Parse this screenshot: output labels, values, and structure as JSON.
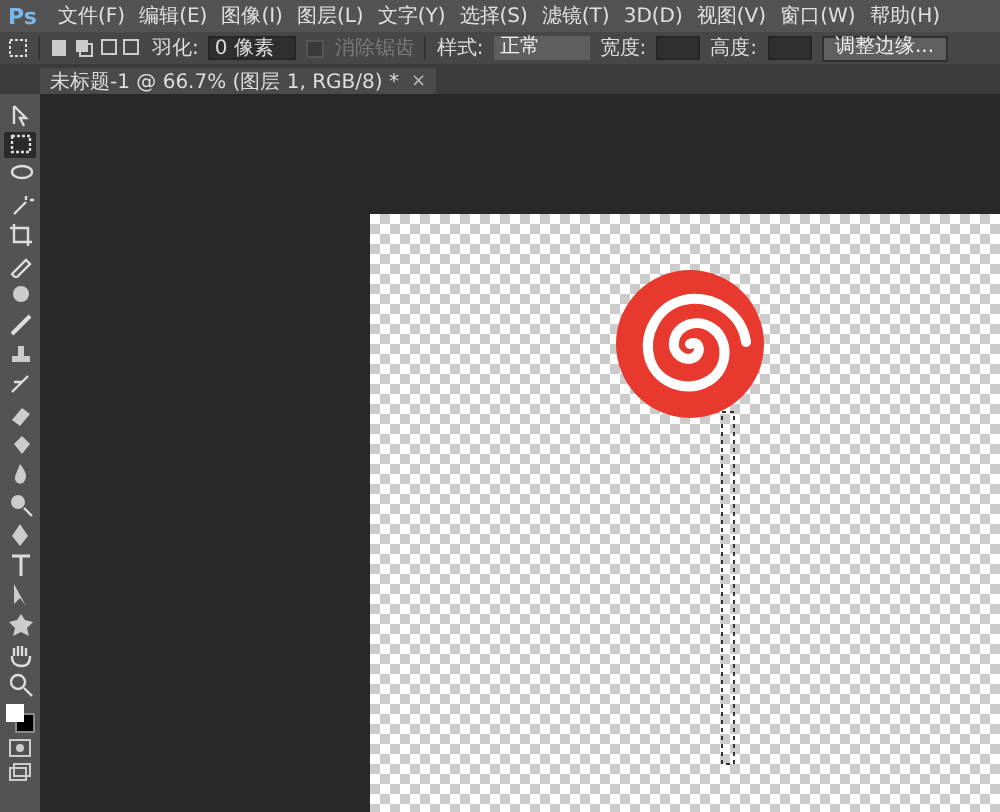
{
  "app": {
    "logo": "Ps"
  },
  "menu": [
    "文件(F)",
    "编辑(E)",
    "图像(I)",
    "图层(L)",
    "文字(Y)",
    "选择(S)",
    "滤镜(T)",
    "3D(D)",
    "视图(V)",
    "窗口(W)",
    "帮助(H)"
  ],
  "options": {
    "feather_label": "羽化:",
    "feather_value": "0 像素",
    "antialias": {
      "label": "消除锯齿",
      "checked": false,
      "disabled": true
    },
    "style_label": "样式:",
    "style_value": "正常",
    "width_label": "宽度:",
    "height_label": "高度:",
    "refine_button": "调整边缘..."
  },
  "document_tab": {
    "title": "未标题-1 @ 66.7% (图层 1, RGB/8) *",
    "close": "×"
  },
  "tools": [
    {
      "kind": "move",
      "selected": false
    },
    {
      "kind": "marquee",
      "selected": true
    },
    {
      "kind": "lasso",
      "selected": false
    },
    {
      "kind": "wand",
      "selected": false
    },
    {
      "kind": "crop",
      "selected": false
    },
    {
      "kind": "eyedropper",
      "selected": false
    },
    {
      "kind": "heal",
      "selected": false
    },
    {
      "kind": "brush",
      "selected": false
    },
    {
      "kind": "stamp",
      "selected": false
    },
    {
      "kind": "history",
      "selected": false
    },
    {
      "kind": "eraser",
      "selected": false
    },
    {
      "kind": "bucket",
      "selected": false
    },
    {
      "kind": "blur",
      "selected": false
    },
    {
      "kind": "dodge",
      "selected": false
    },
    {
      "kind": "pen",
      "selected": false
    },
    {
      "kind": "type",
      "selected": false
    },
    {
      "kind": "select",
      "selected": false
    },
    {
      "kind": "shape",
      "selected": false
    },
    {
      "kind": "hand",
      "selected": false
    },
    {
      "kind": "zoom",
      "selected": false
    }
  ]
}
